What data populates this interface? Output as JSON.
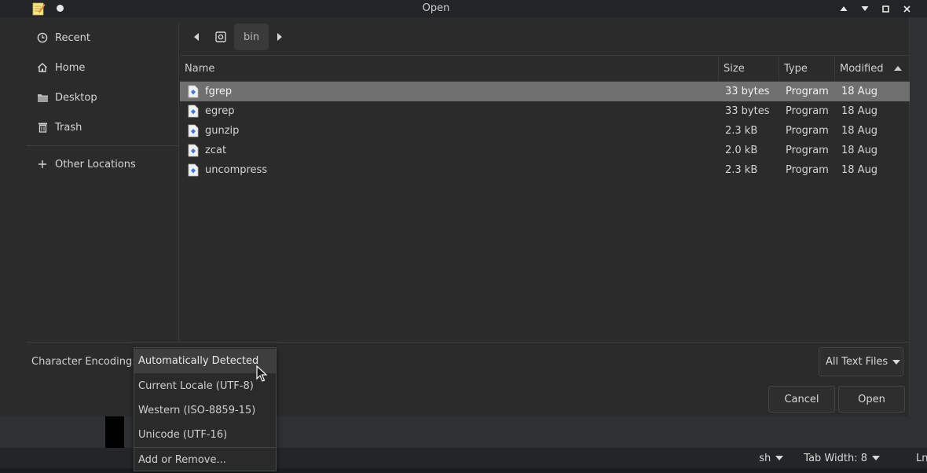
{
  "window": {
    "title": "Open"
  },
  "sidebar": {
    "items": [
      {
        "label": "Recent",
        "icon": "clock-icon"
      },
      {
        "label": "Home",
        "icon": "home-icon"
      },
      {
        "label": "Desktop",
        "icon": "folder-icon"
      },
      {
        "label": "Trash",
        "icon": "trash-icon"
      },
      {
        "label": "Other Locations",
        "icon": "plus-icon"
      }
    ]
  },
  "pathbar": {
    "crumb": "bin"
  },
  "filelist": {
    "columns": [
      "Name",
      "Size",
      "Type",
      "Modified"
    ],
    "rows": [
      {
        "name": "fgrep",
        "size": "33 bytes",
        "type": "Program",
        "modified": "18 Aug"
      },
      {
        "name": "egrep",
        "size": "33 bytes",
        "type": "Program",
        "modified": "18 Aug"
      },
      {
        "name": "gunzip",
        "size": "2.3 kB",
        "type": "Program",
        "modified": "18 Aug"
      },
      {
        "name": "zcat",
        "size": "2.0 kB",
        "type": "Program",
        "modified": "18 Aug"
      },
      {
        "name": "uncompress",
        "size": "2.3 kB",
        "type": "Program",
        "modified": "18 Aug"
      }
    ],
    "selected_index": 0
  },
  "encoding": {
    "label": "Character Encoding:",
    "options": [
      "Automatically Detected",
      "Current Locale (UTF-8)",
      "Western (ISO-8859-15)",
      "Unicode (UTF-16)"
    ],
    "add_remove": "Add or Remove...",
    "active_index": 0
  },
  "filter": {
    "label": "All Text Files"
  },
  "buttons": {
    "cancel": "Cancel",
    "open": "Open"
  },
  "statusbar": {
    "language": "sh",
    "tab_width": "Tab Width: 8",
    "position": "Ln"
  },
  "colors": {
    "selected_row": "#6f6f6f",
    "background": "#2b2b2b",
    "file_icon": "#3d7bd8"
  }
}
